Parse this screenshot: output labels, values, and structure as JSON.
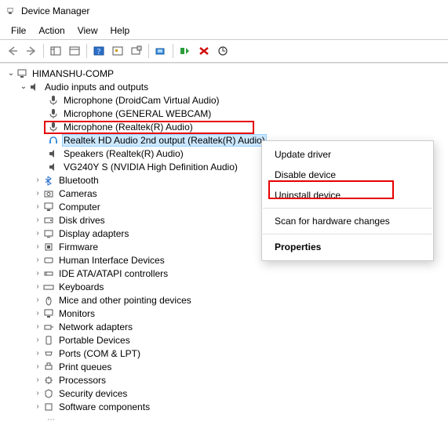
{
  "window": {
    "title": "Device Manager"
  },
  "menubar": [
    "File",
    "Action",
    "View",
    "Help"
  ],
  "tree": {
    "root": "HIMANSHU-COMP",
    "audio_category": "Audio inputs and outputs",
    "audio_items": [
      "Microphone (DroidCam Virtual Audio)",
      "Microphone (GENERAL WEBCAM)",
      "Microphone (Realtek(R) Audio)",
      "Realtek HD Audio 2nd output (Realtek(R) Audio)",
      "Speakers (Realtek(R) Audio)",
      "VG240Y S (NVIDIA High Definition Audio)"
    ],
    "categories": [
      "Bluetooth",
      "Cameras",
      "Computer",
      "Disk drives",
      "Display adapters",
      "Firmware",
      "Human Interface Devices",
      "IDE ATA/ATAPI controllers",
      "Keyboards",
      "Mice and other pointing devices",
      "Monitors",
      "Network adapters",
      "Portable Devices",
      "Ports (COM & LPT)",
      "Print queues",
      "Processors",
      "Security devices",
      "Software components"
    ]
  },
  "context_menu": {
    "items": [
      "Update driver",
      "Disable device",
      "Uninstall device",
      "Scan for hardware changes",
      "Properties"
    ]
  }
}
